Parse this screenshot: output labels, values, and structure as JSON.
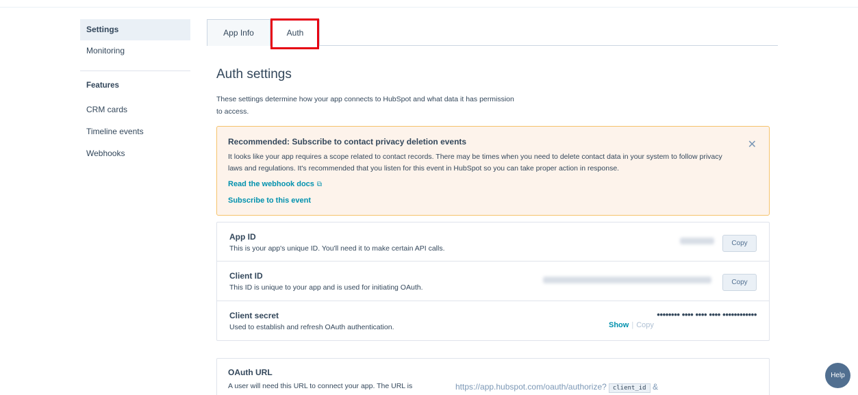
{
  "sidebar": {
    "items": [
      {
        "label": "Settings"
      },
      {
        "label": "Monitoring"
      }
    ],
    "features_heading": "Features",
    "feature_items": [
      {
        "label": "CRM cards"
      },
      {
        "label": "Timeline events"
      },
      {
        "label": "Webhooks"
      }
    ]
  },
  "tabs": [
    {
      "label": "App Info"
    },
    {
      "label": "Auth"
    }
  ],
  "main": {
    "title": "Auth settings",
    "intro": "These settings determine how your app connects to HubSpot and what data it has permission to access."
  },
  "alert": {
    "title": "Recommended: Subscribe to contact privacy deletion events",
    "body": "It looks like your app requires a scope related to contact records. There may be times when you need to delete contact data in your system to follow privacy laws and regulations. It's recommended that you listen for this event in HubSpot so you can take proper action in response.",
    "link_docs": "Read the webhook docs",
    "link_subscribe": "Subscribe to this event",
    "close_glyph": "✕",
    "external_glyph": "⧉"
  },
  "credentials": {
    "app_id": {
      "title": "App ID",
      "description": "This is your app's unique ID. You'll need it to make certain API calls.",
      "copy_label": "Copy"
    },
    "client_id": {
      "title": "Client ID",
      "description": "This ID is unique to your app and is used for initiating OAuth.",
      "copy_label": "Copy"
    },
    "client_secret": {
      "title": "Client secret",
      "description": "Used to establish and refresh OAuth authentication.",
      "masked_value": "•••••••• •••• •••• •••• ••••••••••••",
      "show_label": "Show",
      "separator": "|",
      "copy_label": "Copy"
    }
  },
  "oauth": {
    "title": "OAuth URL",
    "description": "A user will need this URL to connect your app. The URL is",
    "url_prefix": "https://app.hubspot.com/oauth/authorize?",
    "param": "client_id",
    "url_suffix": "&"
  },
  "help": {
    "label": "Help"
  },
  "colors": {
    "accent": "#0091ae",
    "highlight": "#e60012",
    "alert_bg": "#fdf3eb",
    "alert_border": "#f5c26b"
  }
}
